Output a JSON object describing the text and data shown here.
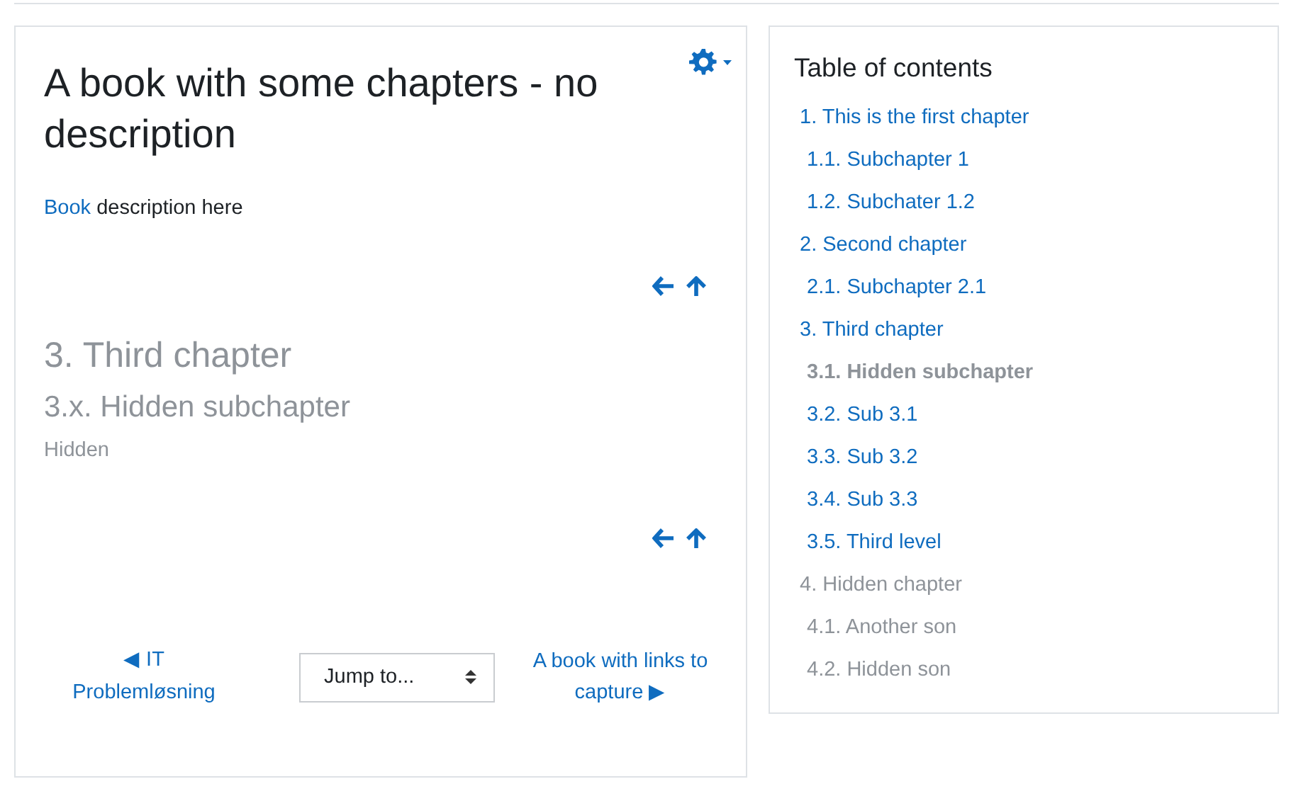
{
  "page_title": "A book with some chapters - no description",
  "description": {
    "link": "Book",
    "text": "description here"
  },
  "chapter": {
    "title": "3. Third chapter",
    "subtitle": "3.x. Hidden subchapter",
    "status": "Hidden",
    "hidden": true
  },
  "navigation": {
    "previous": {
      "arrow": "◀",
      "label": "IT Problemløsning"
    },
    "jump": {
      "value": "Jump to..."
    },
    "next": {
      "label": "A book with links to capture",
      "arrow": "▶"
    }
  },
  "toc": {
    "title": "Table of contents",
    "items": [
      {
        "label": "1. This is the first chapter",
        "hidden": false,
        "selected": false,
        "children": [
          {
            "label": "1.1. Subchapter 1",
            "hidden": false,
            "selected": false
          },
          {
            "label": "1.2. Subchater 1.2",
            "hidden": false,
            "selected": false
          }
        ]
      },
      {
        "label": "2. Second chapter",
        "hidden": false,
        "selected": false,
        "children": [
          {
            "label": "2.1. Subchapter 2.1",
            "hidden": false,
            "selected": false
          }
        ]
      },
      {
        "label": "3. Third chapter",
        "hidden": false,
        "selected": false,
        "children": [
          {
            "label": "3.1. Hidden subchapter",
            "hidden": true,
            "selected": true
          },
          {
            "label": "3.2. Sub 3.1",
            "hidden": false,
            "selected": false
          },
          {
            "label": "3.3. Sub 3.2",
            "hidden": false,
            "selected": false
          },
          {
            "label": "3.4. Sub 3.3",
            "hidden": false,
            "selected": false
          },
          {
            "label": "3.5. Third level",
            "hidden": false,
            "selected": false
          }
        ]
      },
      {
        "label": "4. Hidden chapter",
        "hidden": true,
        "selected": false,
        "children": [
          {
            "label": "4.1. Another son",
            "hidden": true,
            "selected": false
          },
          {
            "label": "4.2. Hidden son",
            "hidden": true,
            "selected": false
          }
        ]
      }
    ]
  }
}
